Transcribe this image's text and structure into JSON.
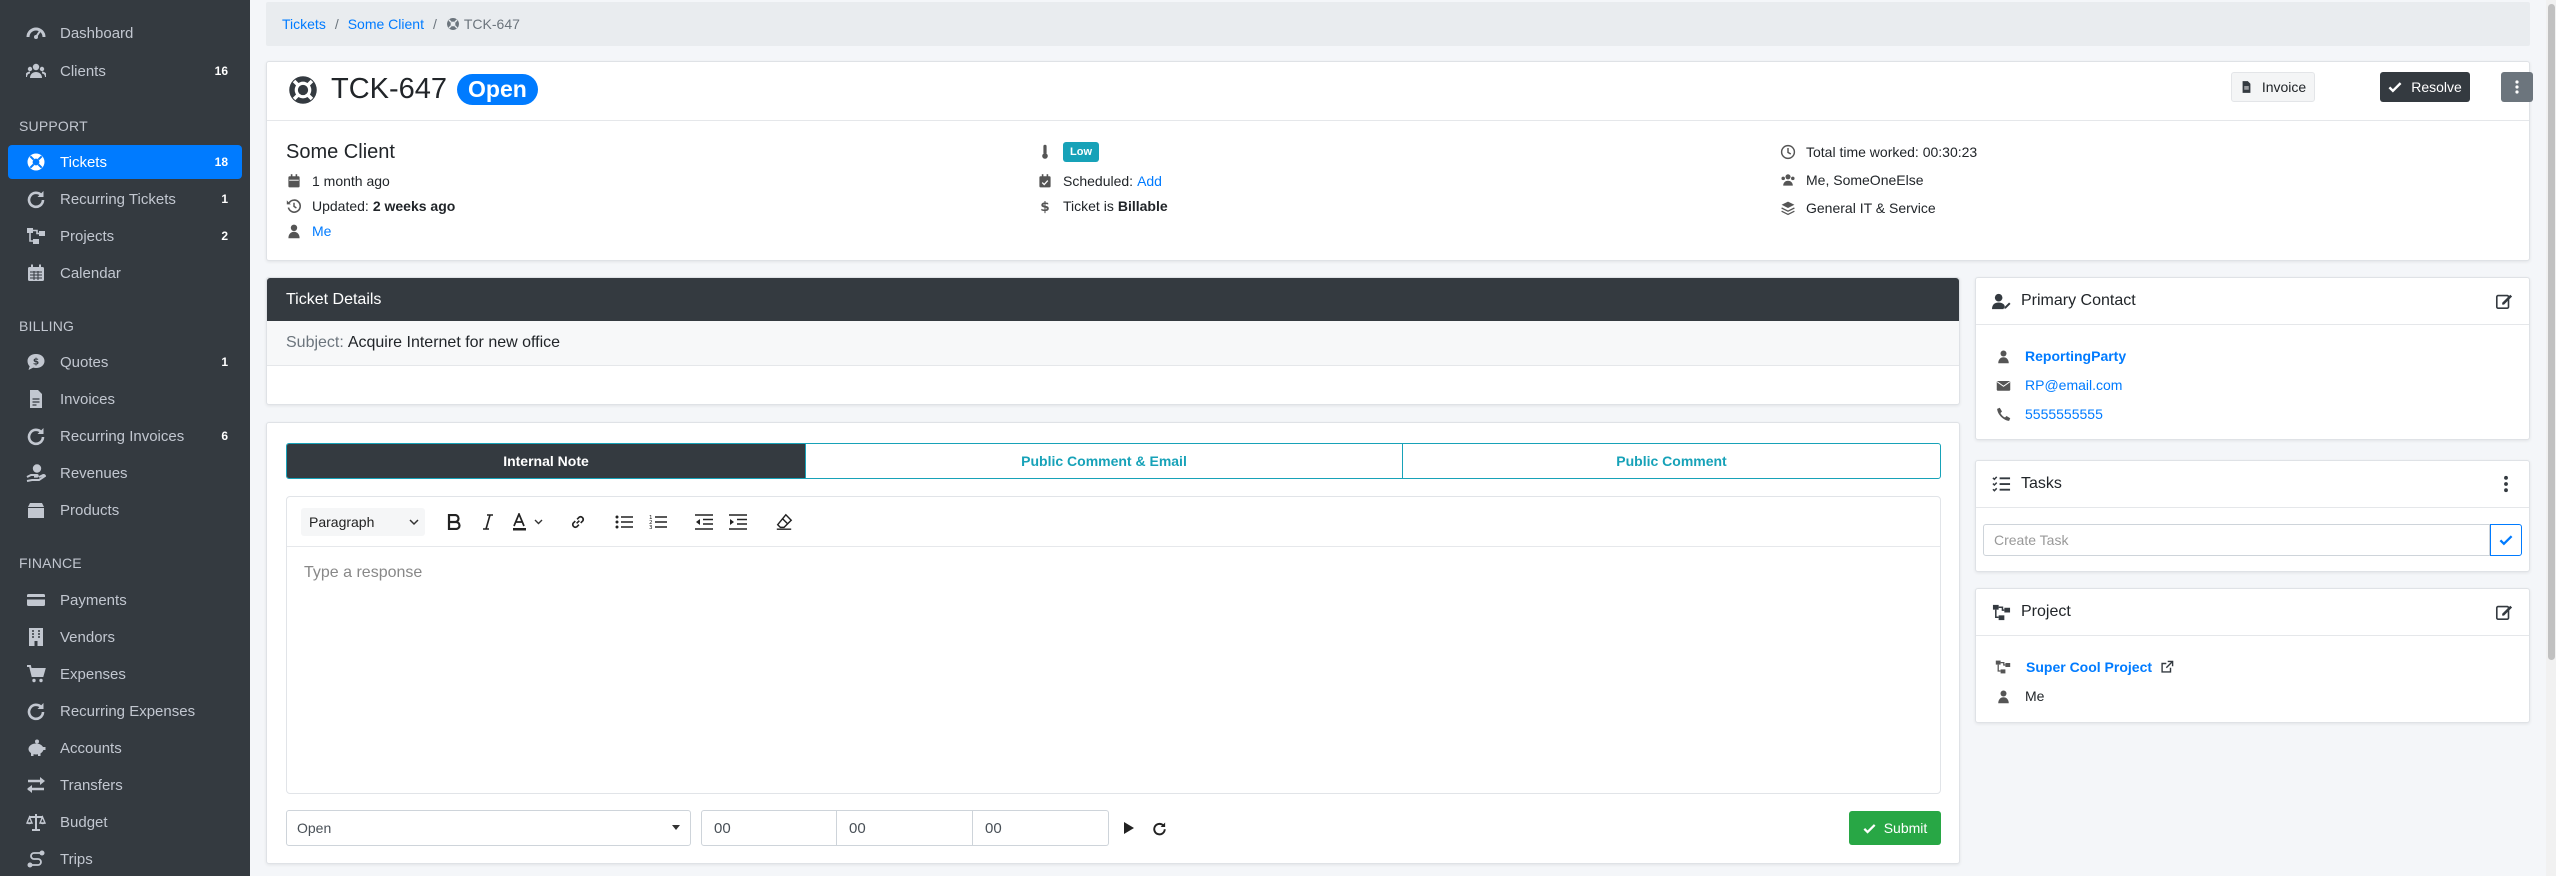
{
  "sidebar": {
    "items": [
      {
        "label": "Dashboard",
        "icon": "gauge-icon",
        "badge": ""
      },
      {
        "label": "Clients",
        "icon": "users-icon",
        "badge": "16"
      },
      {
        "label": "Tickets",
        "icon": "life-ring-icon",
        "badge": "18",
        "active": true
      },
      {
        "label": "Recurring Tickets",
        "icon": "redo-icon",
        "badge": "1"
      },
      {
        "label": "Projects",
        "icon": "project-diagram-icon",
        "badge": "2"
      },
      {
        "label": "Calendar",
        "icon": "calendar-icon",
        "badge": ""
      },
      {
        "label": "Quotes",
        "icon": "comment-dollar-icon",
        "badge": "1"
      },
      {
        "label": "Invoices",
        "icon": "file-invoice-icon",
        "badge": ""
      },
      {
        "label": "Recurring Invoices",
        "icon": "redo-icon",
        "badge": "6"
      },
      {
        "label": "Revenues",
        "icon": "hand-holding-usd-icon",
        "badge": ""
      },
      {
        "label": "Products",
        "icon": "box-icon",
        "badge": ""
      },
      {
        "label": "Payments",
        "icon": "credit-card-icon",
        "badge": ""
      },
      {
        "label": "Vendors",
        "icon": "building-icon",
        "badge": ""
      },
      {
        "label": "Expenses",
        "icon": "shopping-cart-icon",
        "badge": ""
      },
      {
        "label": "Recurring Expenses",
        "icon": "redo-icon",
        "badge": ""
      },
      {
        "label": "Accounts",
        "icon": "piggy-bank-icon",
        "badge": ""
      },
      {
        "label": "Transfers",
        "icon": "exchange-icon",
        "badge": ""
      },
      {
        "label": "Budget",
        "icon": "balance-scale-icon",
        "badge": ""
      },
      {
        "label": "Trips",
        "icon": "route-icon",
        "badge": ""
      }
    ],
    "headers": {
      "support": "SUPPORT",
      "billing": "BILLING",
      "finance": "FINANCE"
    }
  },
  "breadcrumb": {
    "tickets": "Tickets",
    "client": "Some Client",
    "current": "TCK-647",
    "separator": "/"
  },
  "ticket": {
    "number": "TCK-647",
    "status": "Open",
    "client": "Some Client",
    "created": "1 month ago",
    "updated_label": "Updated:",
    "updated_value": "2 weeks ago",
    "assigned": "Me",
    "priority": "Low",
    "scheduled_label": "Scheduled:",
    "scheduled_action": "Add",
    "billable_label": "Ticket is",
    "billable_value": "Billable",
    "time_worked": "Total time worked: 00:30:23",
    "watchers": "Me, SomeOneElse",
    "category": "General IT & Service"
  },
  "actions": {
    "invoice": "Invoice",
    "resolve": "Resolve"
  },
  "details": {
    "title": "Ticket Details",
    "subject_label": "Subject:",
    "subject": "Acquire Internet for new office"
  },
  "reply": {
    "tabs": [
      "Internal Note",
      "Public Comment & Email",
      "Public Comment"
    ],
    "active_tab": 0,
    "block_format": "Paragraph",
    "placeholder": "Type a response",
    "status_value": "Open",
    "hours": "00",
    "minutes": "00",
    "seconds": "00",
    "submit": "Submit"
  },
  "contact": {
    "title": "Primary Contact",
    "name": "ReportingParty",
    "email": "RP@email.com",
    "phone": "5555555555"
  },
  "tasks": {
    "title": "Tasks",
    "placeholder": "Create Task"
  },
  "project": {
    "title": "Project",
    "name": "Super Cool Project",
    "owner": "Me"
  },
  "colors": {
    "primary": "#007bff",
    "dark": "#343a40",
    "info": "#17a2b8",
    "success": "#28a745"
  }
}
